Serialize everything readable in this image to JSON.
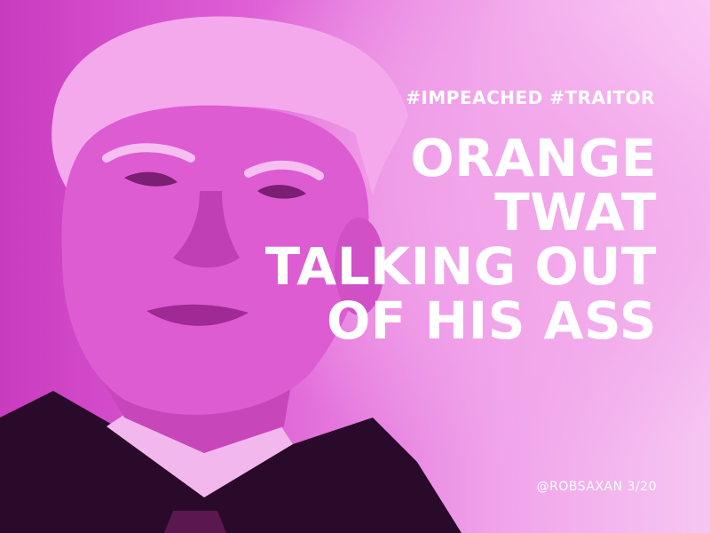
{
  "meme": {
    "hashtags": "#IMPEACHED #TRAITOR",
    "headline_lines": [
      "ORANGE",
      "TWAT",
      "TALKING OUT",
      "OF HIS ASS"
    ],
    "credit": "@ROBSAXAN 3/20"
  },
  "colors": {
    "tint": "#e04fd0",
    "text": "#ffffff"
  }
}
